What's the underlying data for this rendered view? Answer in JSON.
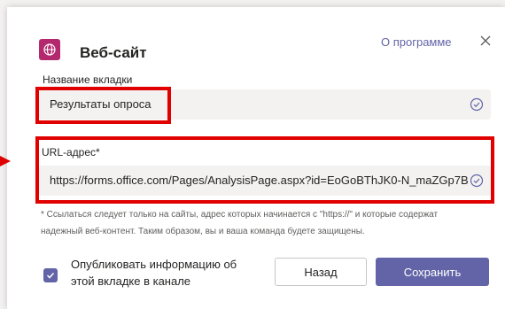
{
  "header": {
    "app_title": "Веб-сайт",
    "about_link": "О программе",
    "app_icon": "globe-icon",
    "close_icon": "close-icon"
  },
  "form": {
    "tab_name_label": "Название вкладки",
    "tab_name_value": "Результаты опроса",
    "url_label": "URL-адрес*",
    "url_value": "https://forms.office.com/Pages/AnalysisPage.aspx?id=EoGoBThJK0-N_maZGp7B\\",
    "hint_line1": "* Ссылаться следует только на сайты, адрес которых начинается с \"https://\" и которые содержат",
    "hint_line2": "надежный веб-контент. Таким образом, вы и ваша команда будете защищены.",
    "post_checkbox_checked": true,
    "post_checkbox_label": "Опубликовать информацию об этой вкладке в канале"
  },
  "buttons": {
    "back": "Назад",
    "save": "Сохранить"
  },
  "colors": {
    "accent": "#6264a7",
    "app_icon_bg": "#b4286e",
    "highlight": "#e00000"
  }
}
